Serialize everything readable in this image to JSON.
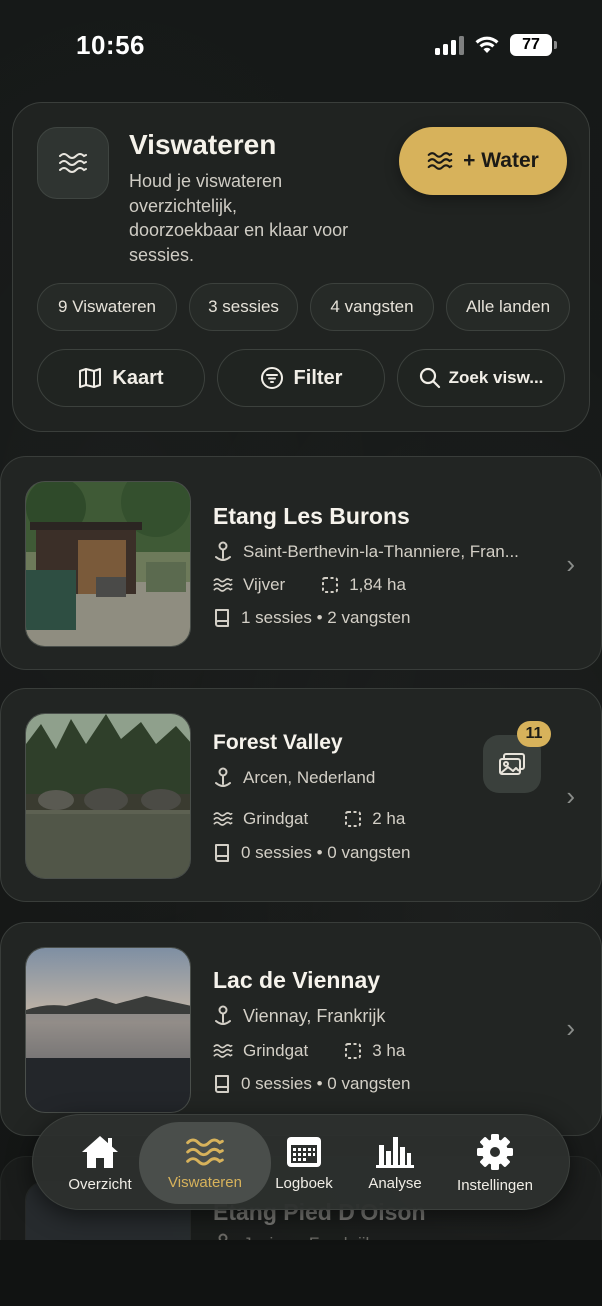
{
  "status_bar": {
    "time": "10:56",
    "battery": "77"
  },
  "header": {
    "title": "Viswateren",
    "subtitle": "Houd je viswateren overzichtelijk, doorzoekbaar en klaar voor sessies.",
    "add_button": "+ Water",
    "icon": "waves-icon"
  },
  "stats": [
    {
      "label": "9 Viswateren"
    },
    {
      "label": "3 sessies"
    },
    {
      "label": "4 vangsten"
    },
    {
      "label": "Alle landen"
    }
  ],
  "actions": {
    "map": {
      "label": "Kaart",
      "icon": "map-icon"
    },
    "filter": {
      "label": "Filter",
      "icon": "filter-icon"
    },
    "search": {
      "placeholder": "Zoek visw...",
      "icon": "search-icon"
    }
  },
  "waters": [
    {
      "name": "Etang Les Burons",
      "location": "Saint-Berthevin-la-Thanniere, Fran...",
      "type": "Vijver",
      "size": "1,84 ha",
      "stats": "1 sessies • 2 vangsten"
    },
    {
      "name": "Forest Valley",
      "location": "Arcen, Nederland",
      "type": "Grindgat",
      "size": "2 ha",
      "stats": "0 sessies • 0 vangsten",
      "photo_count": "11"
    },
    {
      "name": "Lac de Viennay",
      "location": "Viennay, Frankrijk",
      "type": "Grindgat",
      "size": "3 ha",
      "stats": "0 sessies • 0 vangsten"
    },
    {
      "name": "Etang Pied D'Oison",
      "location": "Juvigny, Frankrijk"
    }
  ],
  "tabbar": {
    "items": [
      {
        "label": "Overzicht",
        "icon": "home-icon"
      },
      {
        "label": "Viswateren",
        "icon": "waves-icon"
      },
      {
        "label": "Logboek",
        "icon": "calendar-icon"
      },
      {
        "label": "Analyse",
        "icon": "bar-chart-icon"
      },
      {
        "label": "Instellingen",
        "icon": "gear-icon"
      }
    ],
    "active": "Viswateren"
  },
  "colors": {
    "accent": "#d7b25b",
    "card": "#222523",
    "background": "#141615"
  }
}
